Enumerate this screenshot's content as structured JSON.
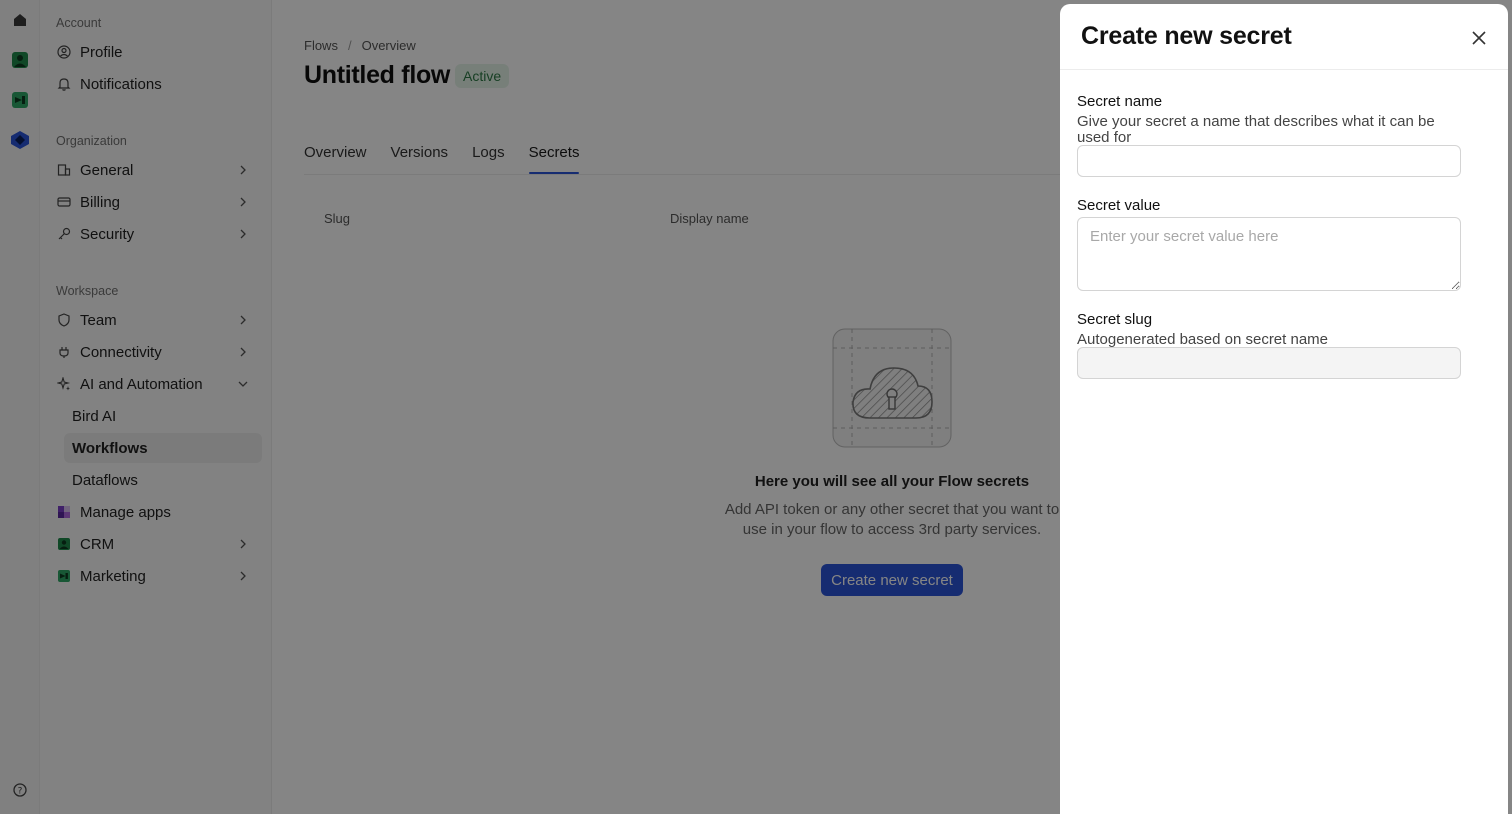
{
  "sidebar": {
    "account_label": "Account",
    "org_label": "Organization",
    "workspace_label": "Workspace",
    "items": {
      "profile": "Profile",
      "notifications": "Notifications",
      "general": "General",
      "billing": "Billing",
      "security": "Security",
      "team": "Team",
      "connectivity": "Connectivity",
      "ai_automation": "AI and Automation",
      "bird_ai": "Bird AI",
      "workflows": "Workflows",
      "dataflows": "Dataflows",
      "manage_apps": "Manage apps",
      "crm": "CRM",
      "marketing": "Marketing"
    }
  },
  "main": {
    "breadcrumb": [
      "Flows",
      "Overview"
    ],
    "title": "Untitled flow",
    "status": "Active",
    "tabs": [
      "Overview",
      "Versions",
      "Logs",
      "Secrets"
    ],
    "active_tab": "Secrets",
    "columns": [
      "Slug",
      "Display name"
    ],
    "empty_title": "Here you will see all your Flow secrets",
    "empty_desc": "Add API token or any other secret that you want to use in your flow to access 3rd party services.",
    "create_button": "Create new secret"
  },
  "drawer": {
    "title": "Create new secret",
    "name_label": "Secret name",
    "name_help": "Give your secret a name that describes what it can be used for",
    "name_value": "",
    "value_label": "Secret value",
    "value_placeholder": "Enter your secret value here",
    "slug_label": "Secret slug",
    "slug_help": "Autogenerated based on secret name",
    "slug_value": ""
  },
  "colors": {
    "accent": "#2b55d8",
    "active_badge_bg": "#e5f3e8",
    "active_badge_text": "#2d7a45",
    "overlay": "rgba(0,0,0,0.48)"
  }
}
